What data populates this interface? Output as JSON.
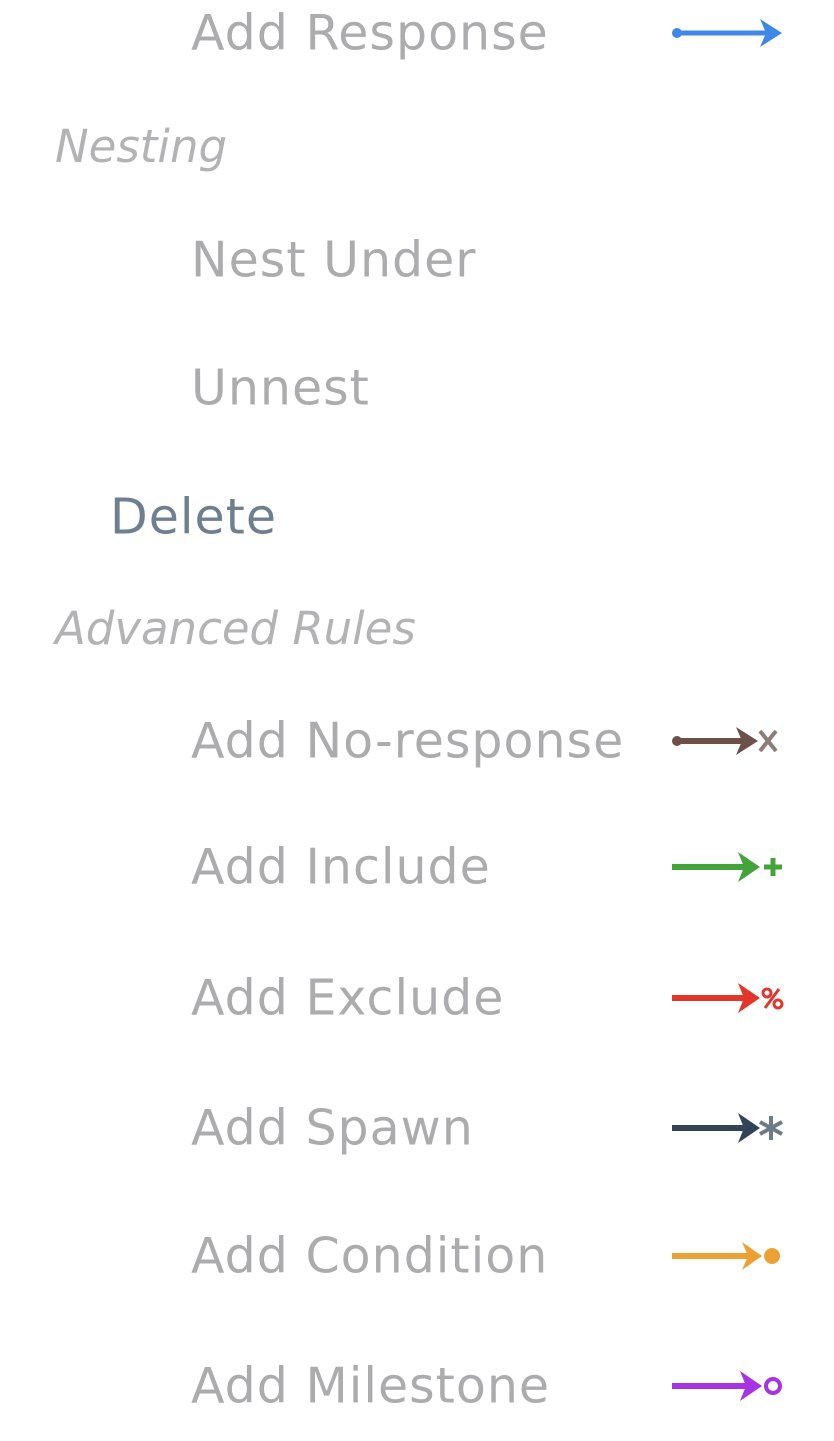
{
  "menu": {
    "add_response": {
      "label": "Add Response",
      "icon": "response-arrow-icon",
      "color": "#3f88e8"
    },
    "nesting": {
      "heading": "Nesting",
      "nest_under": "Nest Under",
      "unnest": "Unnest"
    },
    "delete": "Delete",
    "advanced": {
      "heading": "Advanced Rules",
      "items": [
        {
          "label": "Add No-response",
          "icon": "no-response-arrow-icon",
          "color": "#6b5148"
        },
        {
          "label": "Add Include",
          "icon": "include-arrow-icon",
          "color": "#44a33a"
        },
        {
          "label": "Add Exclude",
          "icon": "exclude-arrow-icon",
          "color": "#e2362d"
        },
        {
          "label": "Add Spawn",
          "icon": "spawn-arrow-icon",
          "color": "#334359"
        },
        {
          "label": "Add Condition",
          "icon": "condition-arrow-icon",
          "color": "#eba134"
        },
        {
          "label": "Add Milestone",
          "icon": "milestone-arrow-icon",
          "color": "#a634e3"
        }
      ]
    }
  }
}
